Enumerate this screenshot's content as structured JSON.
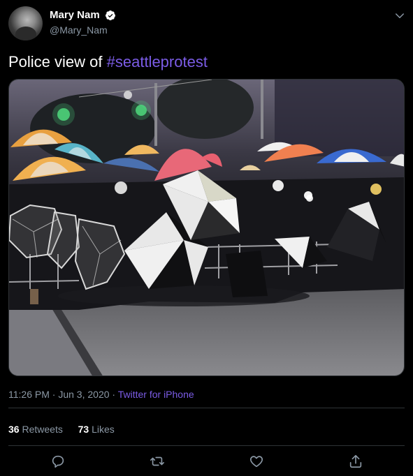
{
  "tweet": {
    "display_name": "Mary Nam",
    "handle": "@Mary_Nam",
    "text_plain": "Police view of ",
    "hashtag": "#seattleprotest",
    "time": "11:26 PM",
    "sep1": " · ",
    "date": "Jun 3, 2020",
    "sep2": " · ",
    "source": "Twitter for iPhone",
    "retweets_count": "36",
    "retweets_label": "Retweets",
    "likes_count": "73",
    "likes_label": "Likes"
  },
  "icons": {
    "verified": "verified-badge-icon",
    "menu": "chevron-down-icon",
    "reply": "reply-icon",
    "retweet": "retweet-icon",
    "like": "heart-icon",
    "share": "share-icon"
  },
  "colors": {
    "background": "#000000",
    "accent": "#7b5ce6",
    "muted": "#8b98a5",
    "divider": "#2f3336"
  }
}
